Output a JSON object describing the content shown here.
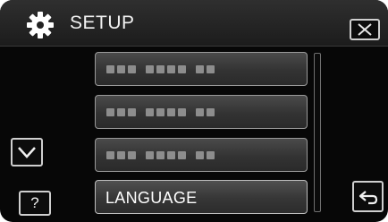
{
  "header": {
    "title": "SETUP",
    "icon": "gear-icon"
  },
  "controls": {
    "close_icon": "close-icon",
    "down_icon": "chevron-down-icon",
    "help_label": "?",
    "back_icon": "return-arrow-icon"
  },
  "menu": {
    "items": [
      {
        "label": "",
        "state": "placeholder"
      },
      {
        "label": "",
        "state": "placeholder"
      },
      {
        "label": "",
        "state": "placeholder"
      },
      {
        "label": "LANGUAGE",
        "state": "enabled"
      }
    ]
  }
}
